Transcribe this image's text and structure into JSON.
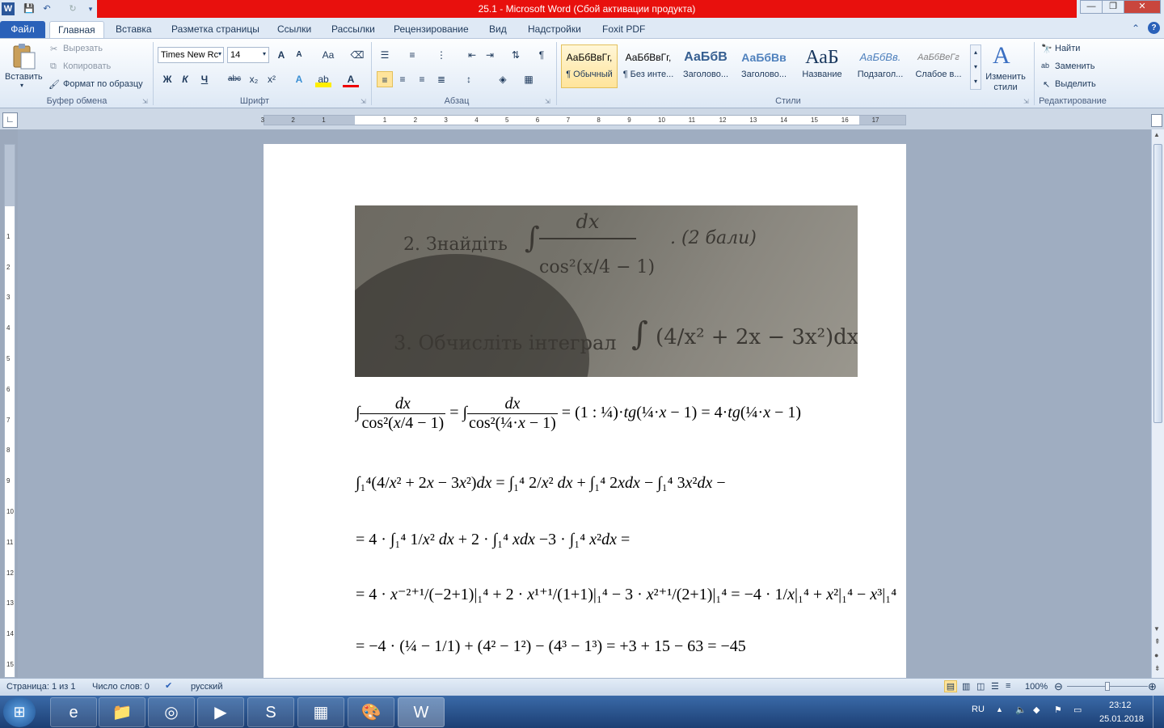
{
  "window": {
    "title": "25.1  -  Microsoft Word (Сбой активации продукта)",
    "controls": {
      "minimize": "—",
      "restore": "❐",
      "close": "✕"
    }
  },
  "qat": {
    "word_icon": "W",
    "save": "💾",
    "undo": "↶",
    "redo": "↻"
  },
  "tabs": [
    "Файл",
    "Главная",
    "Вставка",
    "Разметка страницы",
    "Ссылки",
    "Рассылки",
    "Рецензирование",
    "Вид",
    "Надстройки",
    "Foxit PDF"
  ],
  "ribbon": {
    "clipboard": {
      "paste": "Вставить",
      "cut": "Вырезать",
      "copy": "Копировать",
      "format_painter": "Формат по образцу",
      "group": "Буфер обмена"
    },
    "font": {
      "family": "Times New Rc",
      "size": "14",
      "grow": "A",
      "shrink": "A",
      "case": "Aa",
      "clear": "⌫",
      "bold": "Ж",
      "italic": "К",
      "underline": "Ч",
      "strike": "abc",
      "sub": "x₂",
      "sup": "x²",
      "effects": "A",
      "highlight": "ab",
      "color": "A",
      "group": "Шрифт"
    },
    "paragraph": {
      "group": "Абзац"
    },
    "styles": {
      "items": [
        {
          "preview": "АаБбВвГг,",
          "name": "¶ Обычный"
        },
        {
          "preview": "АаБбВвГг,",
          "name": "¶ Без инте..."
        },
        {
          "preview": "АаБбВ",
          "name": "Заголово..."
        },
        {
          "preview": "АаБбВв",
          "name": "Заголово..."
        },
        {
          "preview": "АаБ",
          "name": "Название"
        },
        {
          "preview": "АаБбВв.",
          "name": "Подзагол..."
        },
        {
          "preview": "АаБбВеГг",
          "name": "Слабое в..."
        }
      ],
      "change_styles": "Изменить стили",
      "group": "Стили"
    },
    "editing": {
      "find": "Найти",
      "replace": "Заменить",
      "select": "Выделить",
      "group": "Редактирование"
    }
  },
  "ruler": {
    "h_ticks": [
      "3",
      "2",
      "1",
      "1",
      "2",
      "3",
      "4",
      "5",
      "6",
      "7",
      "8",
      "9",
      "10",
      "11",
      "12",
      "13",
      "14",
      "15",
      "16",
      "17"
    ],
    "v_ticks": [
      "1",
      "2",
      "3",
      "4",
      "5",
      "6",
      "7",
      "8",
      "9",
      "10",
      "11",
      "12",
      "13",
      "14",
      "15"
    ]
  },
  "photo": {
    "task2_label": "2. Знайдіть",
    "task2_points": ". (2 бали)",
    "task3_label": "3. Обчисліть інтеграл"
  },
  "status": {
    "page": "Страница: 1 из 1",
    "words": "Число слов: 0",
    "language": "русский",
    "zoom": "100%"
  },
  "taskbar": {
    "lang": "RU",
    "time": "23:12",
    "date": "25.01.2018"
  }
}
